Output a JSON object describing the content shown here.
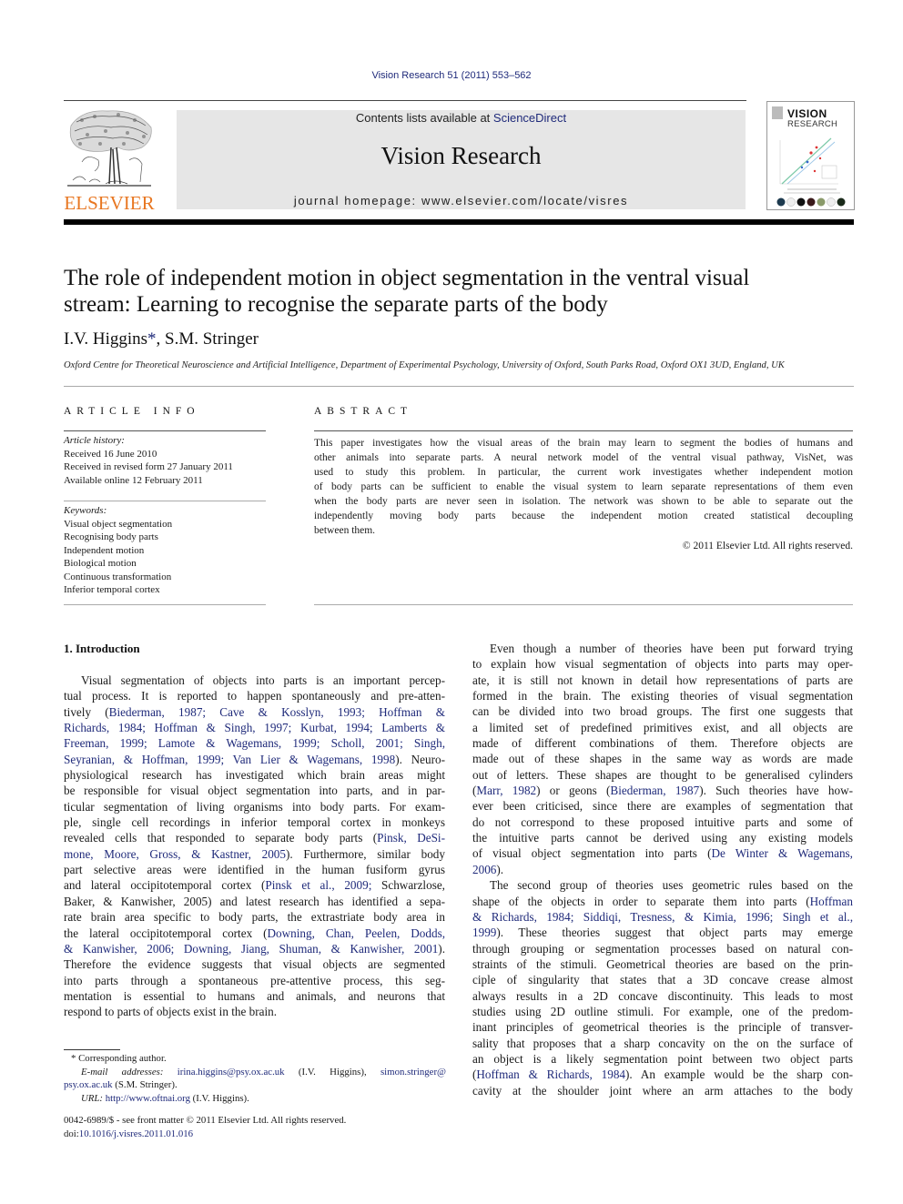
{
  "header": {
    "citation": "Vision Research 51 (2011) 553–562",
    "contents_prefix": "Contents lists available at ",
    "contents_link": "ScienceDirect",
    "journal_title": "Vision Research",
    "homepage": "journal homepage: www.elsevier.com/locate/visres",
    "publisher_logo_text": "ELSEVIER",
    "cover": {
      "line1": "VISION",
      "line2": "RESEARCH"
    }
  },
  "article": {
    "title_line1": "The role of independent motion in object segmentation in the ventral visual",
    "title_line2": "stream: Learning to recognise the separate parts of the body",
    "author1": "I.V. Higgins",
    "author_mark": "*",
    "author_sep": ", ",
    "author2": "S.M. Stringer",
    "affiliation": "Oxford Centre for Theoretical Neuroscience and Artificial Intelligence, Department of Experimental Psychology, University of Oxford, South Parks Road, Oxford OX1 3UD, England, UK"
  },
  "article_info": {
    "heading": "ARTICLE INFO",
    "history_label": "Article history:",
    "history": [
      "Received 16 June 2010",
      "Received in revised form 27 January 2011",
      "Available online 12 February 2011"
    ],
    "keywords_label": "Keywords:",
    "keywords": [
      "Visual object segmentation",
      "Recognising body parts",
      "Independent motion",
      "Biological motion",
      "Continuous transformation",
      "Inferior temporal cortex"
    ]
  },
  "abstract": {
    "heading": "ABSTRACT",
    "lines": [
      "This paper investigates how the visual areas of the brain may learn to segment the bodies of humans and",
      "other animals into separate parts. A neural network model of the ventral visual pathway, VisNet, was",
      "used to study this problem. In particular, the current work investigates whether independent motion",
      "of body parts can be sufficient to enable the visual system to learn separate representations of them even",
      "when the body parts are never seen in isolation. The network was shown to be able to separate out the",
      "independently moving body parts because the independent motion created statistical decoupling",
      "between them."
    ],
    "copyright": "© 2011 Elsevier Ltd. All rights reserved."
  },
  "intro": {
    "heading": "1. Introduction",
    "left_lines": [
      [
        "Visual segmentation of objects into parts is an important percep-"
      ],
      [
        "tual process. It is reported to happen spontaneously and pre-atten-"
      ],
      [
        "tively (",
        {
          "link": "Biederman, 1987; Cave & Kosslyn, 1993; Hoffman &"
        }
      ],
      [
        {
          "link": "Richards, 1984; Hoffman & Singh, 1997; Kurbat, 1994; Lamberts &"
        }
      ],
      [
        {
          "link": "Freeman, 1999; Lamote & Wagemans, 1999; Scholl, 2001; Singh,"
        }
      ],
      [
        {
          "link": "Seyranian, & Hoffman, 1999; Van Lier & Wagemans, 1998"
        },
        "). Neuro-"
      ],
      [
        "physiological research has investigated which brain areas might"
      ],
      [
        "be responsible for visual object segmentation into parts, and in par-"
      ],
      [
        "ticular segmentation of living organisms into body parts. For exam-"
      ],
      [
        "ple, single cell recordings in inferior temporal cortex in monkeys"
      ],
      [
        "revealed cells that responded to separate body parts (",
        {
          "link": "Pinsk, DeSi-"
        }
      ],
      [
        {
          "link": "mone, Moore, Gross, & Kastner, 2005"
        },
        "). Furthermore, similar body"
      ],
      [
        "part selective areas were identified in the human fusiform gyrus"
      ],
      [
        "and lateral occipitotemporal cortex (",
        {
          "link": "Pinsk et al., 2009;"
        },
        " Schwarzlose,"
      ],
      [
        "Baker, & Kanwisher, 2005) and latest research has identified a sepa-"
      ],
      [
        "rate brain area specific to body parts, the extrastriate body area in"
      ],
      [
        "the lateral occipitotemporal cortex (",
        {
          "link": "Downing, Chan, Peelen, Dodds,"
        }
      ],
      [
        {
          "link": "& Kanwisher, 2006; Downing, Jiang, Shuman, & Kanwisher, 2001"
        },
        ")."
      ],
      [
        "Therefore the evidence suggests that visual objects are segmented"
      ],
      [
        "into parts through a spontaneous pre-attentive process, this seg-"
      ],
      [
        "mentation is essential to humans and animals, and neurons that"
      ],
      [
        "respond to parts of objects exist in the brain."
      ]
    ],
    "right_lines": [
      [
        "Even though a number of theories have been put forward trying"
      ],
      [
        "to explain how visual segmentation of objects into parts may oper-"
      ],
      [
        "ate, it is still not known in detail how representations of parts are"
      ],
      [
        "formed in the brain. The existing theories of visual segmentation"
      ],
      [
        "can be divided into two broad groups. The first one suggests that"
      ],
      [
        "a limited set of predefined primitives exist, and all objects are"
      ],
      [
        "made of different combinations of them. Therefore objects are"
      ],
      [
        "made out of these shapes in the same way as words are made"
      ],
      [
        "out of letters. These shapes are thought to be generalised cylinders"
      ],
      [
        "(",
        {
          "link": "Marr, 1982"
        },
        ") or geons (",
        {
          "link": "Biederman, 1987"
        },
        "). Such theories have how-"
      ],
      [
        "ever been criticised, since there are examples of segmentation that"
      ],
      [
        "do not correspond to these proposed intuitive parts and some of"
      ],
      [
        "the intuitive parts cannot be derived using any existing models"
      ],
      [
        "of visual object segmentation into parts (",
        {
          "link": "De Winter & Wagemans,"
        }
      ],
      [
        {
          "link": "2006"
        },
        ")."
      ],
      [
        "The second group of theories uses geometric rules based on the"
      ],
      [
        "shape of the objects in order to separate them into parts (",
        {
          "link": "Hoffman"
        }
      ],
      [
        {
          "link": "& Richards, 1984; Siddiqi, Tresness, & Kimia, 1996; Singh et al.,"
        }
      ],
      [
        {
          "link": "1999"
        },
        "). These theories suggest that object parts may emerge"
      ],
      [
        "through grouping or segmentation processes based on natural con-"
      ],
      [
        "straints of the stimuli. Geometrical theories are based on the prin-"
      ],
      [
        "ciple of singularity that states that a 3D concave crease almost"
      ],
      [
        "always results in a 2D concave discontinuity. This leads to most"
      ],
      [
        "studies using 2D outline stimuli. For example, one of the predom-"
      ],
      [
        "inant principles of geometrical theories is the principle of transver-"
      ],
      [
        "sality that proposes that a sharp concavity on the on the surface of"
      ],
      [
        "an object is a likely segmentation point between two object parts"
      ],
      [
        "(",
        {
          "link": "Hoffman & Richards, 1984"
        },
        "). An example would be the sharp con-"
      ],
      [
        "cavity at the shoulder joint where an arm attaches to the body"
      ]
    ]
  },
  "footnotes": {
    "corresponding": "* Corresponding author.",
    "email_label": "E-mail addresses:",
    "email1": "irina.higgins@psy.ox.ac.uk",
    "email1_who": " (I.V. Higgins), ",
    "email2_a": "simon.stringer@",
    "email2_b": "psy.ox.ac.uk",
    "email2_who": " (S.M. Stringer).",
    "url_label": "URL:",
    "url": "http://www.oftnai.org",
    "url_who": " (I.V. Higgins).",
    "front_matter": "0042-6989/$ - see front matter © 2011 Elsevier Ltd. All rights reserved.",
    "doi_label": "doi:",
    "doi": "10.1016/j.visres.2011.01.016"
  }
}
